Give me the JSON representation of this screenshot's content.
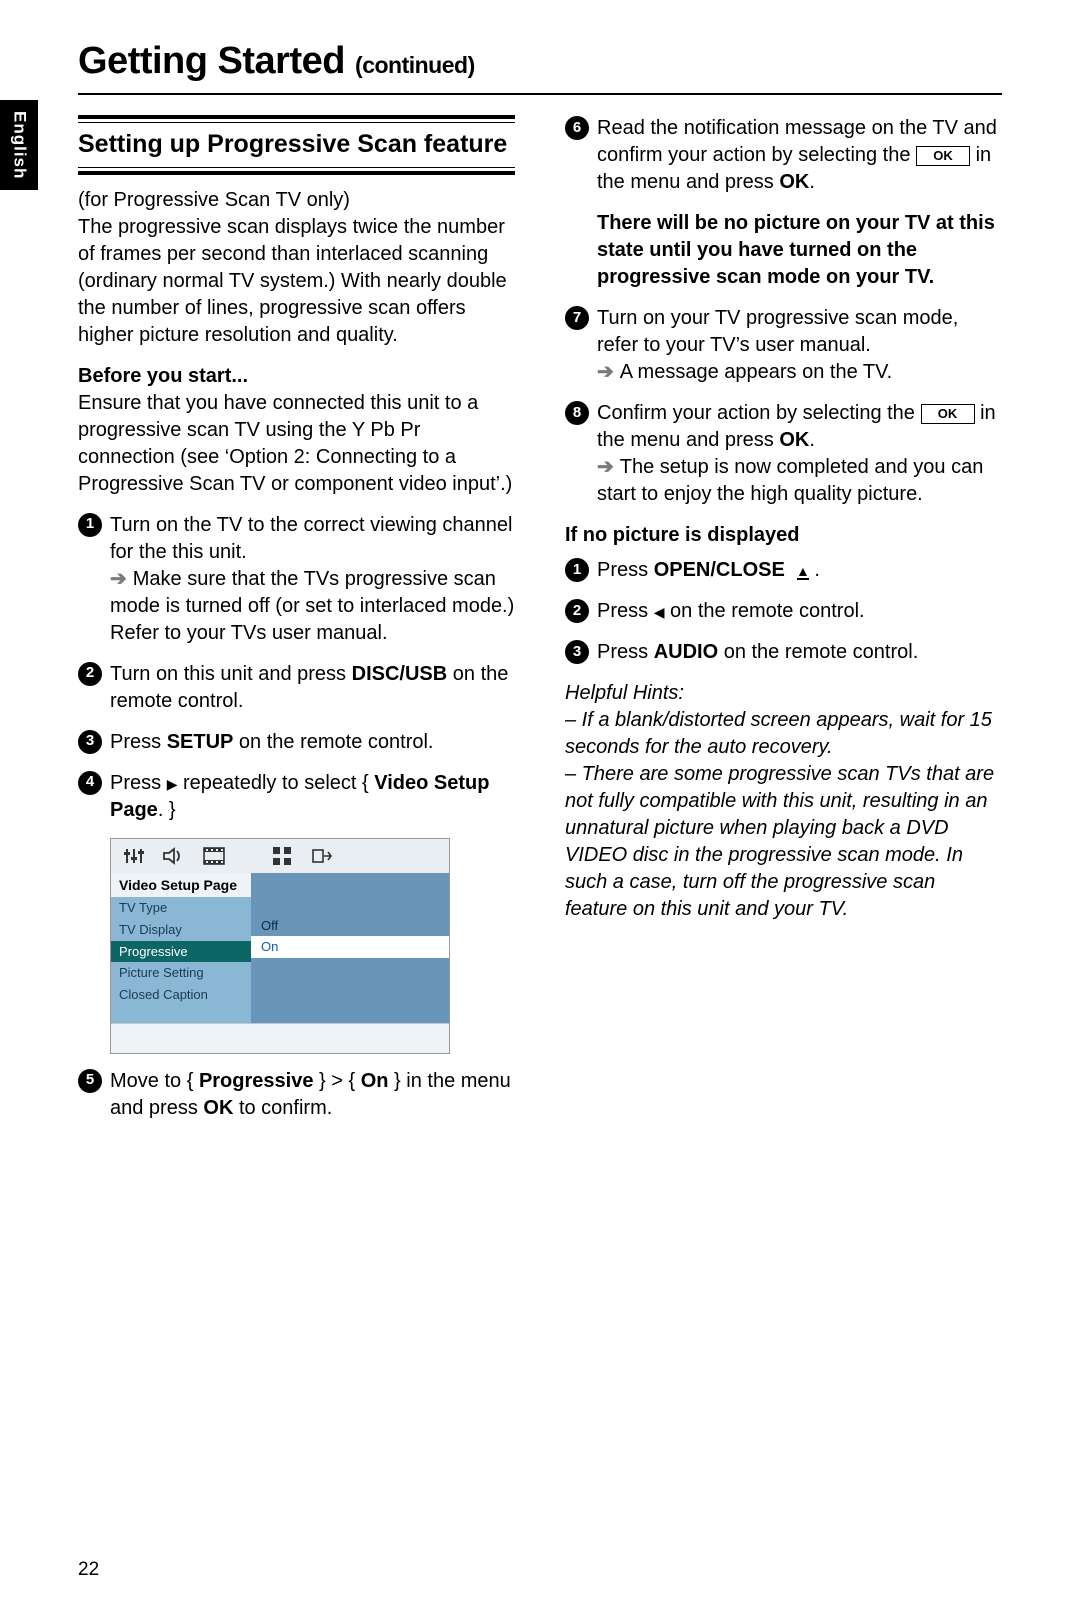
{
  "language_tab": "English",
  "page_number": "22",
  "page_title_main": "Getting Started",
  "page_title_cont": "(continued)",
  "section_title": "Setting up Progressive Scan feature",
  "intro_note": "(for Progressive Scan TV only)",
  "intro_body": "The progressive scan displays twice the number of frames per second than interlaced scanning (ordinary normal TV system.) With nearly double the number of lines, progressive scan offers higher picture resolution and quality.",
  "before_start_head": "Before you start...",
  "before_start_body": "Ensure that you have connected this unit to a progressive scan TV using the Y Pb Pr connection (see ‘Option 2: Connecting to a Progressive Scan TV or component video input’.)",
  "step1_a": "Turn on the TV to the correct viewing channel for the this unit.",
  "step1_b": "Make sure that the TVs progressive scan mode is turned off (or set to interlaced mode.) Refer to your TVs user manual.",
  "step2_pre": "Turn on this unit and press ",
  "step2_bold": "DISC/USB",
  "step2_post": " on the remote control.",
  "step3_pre": "Press ",
  "step3_bold": "SETUP",
  "step3_post": " on the remote control.",
  "step4_pre": "Press ",
  "step4_mid": " repeatedly to select { ",
  "step4_bold": "Video Setup Page",
  "step4_post": ". }",
  "step5_pre": "Move to { ",
  "step5_b1": "Progressive",
  "step5_mid": " } > { ",
  "step5_b2": "On",
  "step5_mid2": " } in the menu and press ",
  "step5_b3": "OK",
  "step5_post": " to confirm.",
  "step6_a": "Read the notification message on the TV and confirm your action by selecting the ",
  "step6_ok": "OK",
  "step6_b": " in the menu and press ",
  "step6_b_bold": "OK",
  "step6_c": ".",
  "warning": "There will be no picture on your TV at this state until you have turned on the progressive scan mode on your TV.",
  "step7_a": "Turn on your TV progressive scan mode, refer to your TV’s user manual.",
  "step7_b": "A message appears on the TV.",
  "step8_a": "Confirm your action by selecting the ",
  "step8_ok": "OK",
  "step8_b": " in the menu and press ",
  "step8_b_bold": "OK",
  "step8_c": ".",
  "step8_d": "The setup is now completed and you can start to enjoy the high quality picture.",
  "no_picture_head": "If no picture is displayed",
  "np1_pre": "Press ",
  "np1_bold": "OPEN/CLOSE",
  "np1_post": " .",
  "np2_pre": "Press ",
  "np2_post": " on the remote control.",
  "np3_pre": "Press ",
  "np3_bold": "AUDIO",
  "np3_post": " on the remote control.",
  "hints_head": "Helpful Hints:",
  "hints_1": "– If a blank/distorted screen appears, wait for 15 seconds for the auto recovery.",
  "hints_2": "– There are some progressive scan TVs that are not fully compatible with this unit, resulting in an unnatural picture when playing back a DVD VIDEO disc in the progressive scan mode. In such a case, turn off the progressive scan feature on this unit and your TV.",
  "osd": {
    "page_title": "Video Setup Page",
    "items": [
      "TV Type",
      "TV Display",
      "Progressive",
      "Picture Setting",
      "Closed Caption"
    ],
    "opt_off": "Off",
    "opt_on": "On"
  }
}
